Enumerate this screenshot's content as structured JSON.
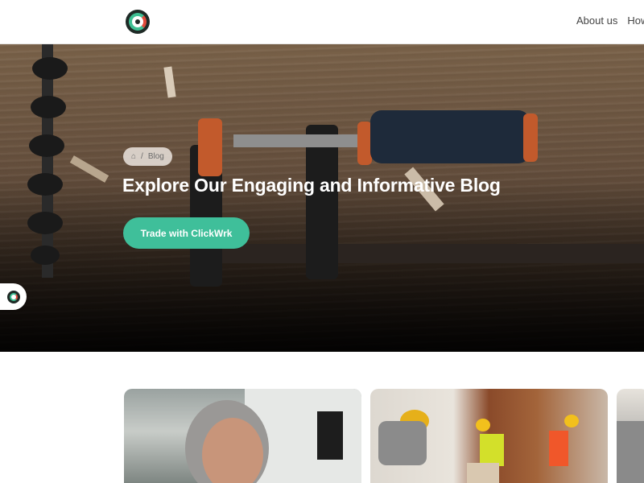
{
  "header": {
    "logo_name": "clickwrk-logo",
    "nav": [
      {
        "label": "About us"
      },
      {
        "label": "How it"
      }
    ]
  },
  "hero": {
    "breadcrumb": {
      "home_icon": "home-icon",
      "separator": "/",
      "current": "Blog"
    },
    "title": "Explore Our Engaging and Informative Blog",
    "cta_label": "Trade with ClickWrk"
  },
  "colors": {
    "accent": "#3fbf9a",
    "logo_dark": "#1f2a26",
    "logo_red": "#e04b3a"
  },
  "cards": [
    {
      "image": "smiling-older-woman-photo"
    },
    {
      "image": "construction-workers-photo"
    },
    {
      "image": "construction-worker-photo"
    }
  ]
}
